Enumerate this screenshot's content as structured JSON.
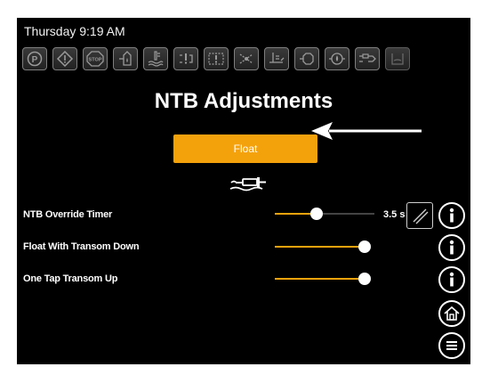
{
  "status": {
    "clock": "Thursday 9:19 AM"
  },
  "toolbar": {
    "icons": [
      "parking-icon",
      "warning-icon",
      "stop-icon",
      "fuel-icon",
      "water-temp-icon",
      "engine-alert-icon",
      "drivetrain-alert-icon",
      "steering-alert-icon",
      "oil-pressure-icon",
      "throttle-icon",
      "oil-icon",
      "trim-tab-icon",
      "bilge-icon"
    ]
  },
  "page": {
    "title": "NTB Adjustments"
  },
  "mode_button": {
    "label": "Float",
    "color": "#f4a20c"
  },
  "settings": [
    {
      "label": "NTB Override Timer",
      "level_fraction": 0.42,
      "value": "3.5 s"
    },
    {
      "label": "Float With Transom Down",
      "level_fraction": 1.0
    },
    {
      "label": "One Tap Transom Up",
      "level_fraction": 1.0
    }
  ],
  "colors": {
    "accent": "#f4a20c",
    "background": "#000000",
    "text": "#ffffff"
  }
}
